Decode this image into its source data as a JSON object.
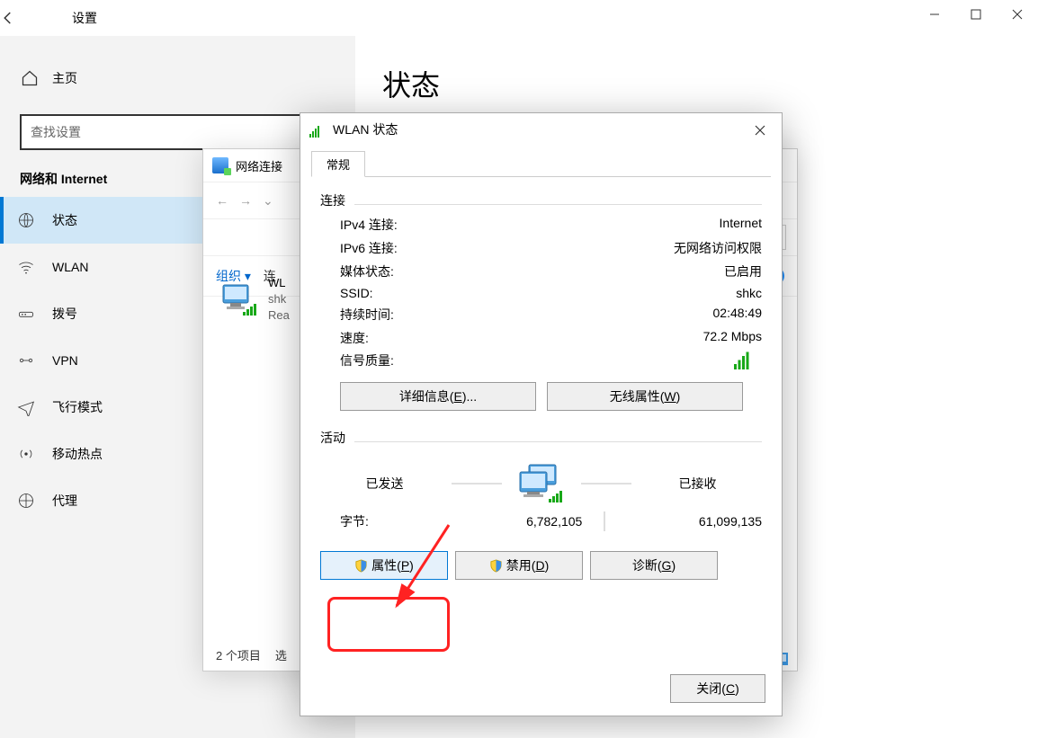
{
  "settings": {
    "title": "设置",
    "home": "主页",
    "searchPlaceholder": "查找设置",
    "section": "网络和 Internet",
    "nav": {
      "status": "状态",
      "wlan": "WLAN",
      "dialup": "拨号",
      "vpn": "VPN",
      "airplane": "飞行模式",
      "hotspot": "移动热点",
      "proxy": "代理"
    }
  },
  "main": {
    "title": "状态"
  },
  "nc": {
    "title": "网络连接",
    "organize": "组织",
    "connect": "连",
    "adapterLine1": "WL",
    "adapterLine2": "shk",
    "adapterLine3": "Rea",
    "itemCount": "2 个项目",
    "selected": "选"
  },
  "sd": {
    "title": "WLAN 状态",
    "tab": "常规",
    "connGroup": "连接",
    "ipv4L": "IPv4 连接:",
    "ipv4V": "Internet",
    "ipv6L": "IPv6 连接:",
    "ipv6V": "无网络访问权限",
    "mediaL": "媒体状态:",
    "mediaV": "已启用",
    "ssidL": "SSID:",
    "ssidV": "shkc",
    "durL": "持续时间:",
    "durV": "02:48:49",
    "speedL": "速度:",
    "speedV": "72.2 Mbps",
    "sigL": "信号质量:",
    "detailsBtnPre": "详细信息(",
    "detailsBtnKey": "E",
    "detailsBtnPost": ")...",
    "wpropBtnPre": "无线属性(",
    "wpropBtnKey": "W",
    "wpropBtnPost": ")",
    "activityGroup": "活动",
    "sent": "已发送",
    "recv": "已接收",
    "bytesL": "字节:",
    "bytesSent": "6,782,105",
    "bytesRecv": "61,099,135",
    "propBtnPre": "属性(",
    "propBtnKey": "P",
    "propBtnPost": ")",
    "disableBtnPre": "禁用(",
    "disableBtnKey": "D",
    "disableBtnPost": ")",
    "diagBtnPre": "诊断(",
    "diagBtnKey": "G",
    "diagBtnPost": ")",
    "closeBtnPre": "关闭(",
    "closeBtnKey": "C",
    "closeBtnPost": ")"
  }
}
